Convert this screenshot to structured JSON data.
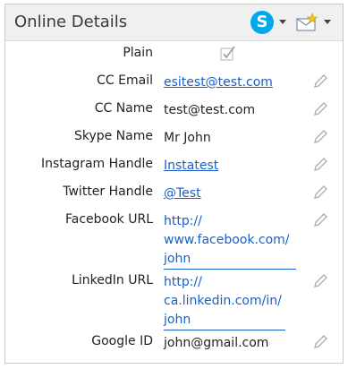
{
  "panel": {
    "title": "Online Details",
    "header_icons": [
      "skype-icon",
      "mail-star-icon"
    ]
  },
  "fields": {
    "plain": {
      "label": "Plain",
      "checked": true
    },
    "cc_email": {
      "label": "CC Email",
      "value": "esitest@test.com"
    },
    "cc_name": {
      "label": "CC Name",
      "value": "test@test.com"
    },
    "skype_name": {
      "label": "Skype Name",
      "value": "Mr John"
    },
    "instagram": {
      "label": "Instagram Handle",
      "value": "Instatest"
    },
    "twitter": {
      "label": "Twitter Handle",
      "value": "@Test"
    },
    "facebook": {
      "label": "Facebook URL",
      "value_lines": [
        "http://",
        "www.facebook.com/",
        "john"
      ]
    },
    "linkedin": {
      "label": "LinkedIn URL",
      "value_lines": [
        "http://",
        "ca.linkedin.com/in/",
        "john"
      ]
    },
    "google": {
      "label": "Google ID",
      "value": "john@gmail.com"
    }
  },
  "colors": {
    "link": "#1a5fc7",
    "header_bg": "#f0f0f0",
    "skype": "#00a9ee"
  }
}
